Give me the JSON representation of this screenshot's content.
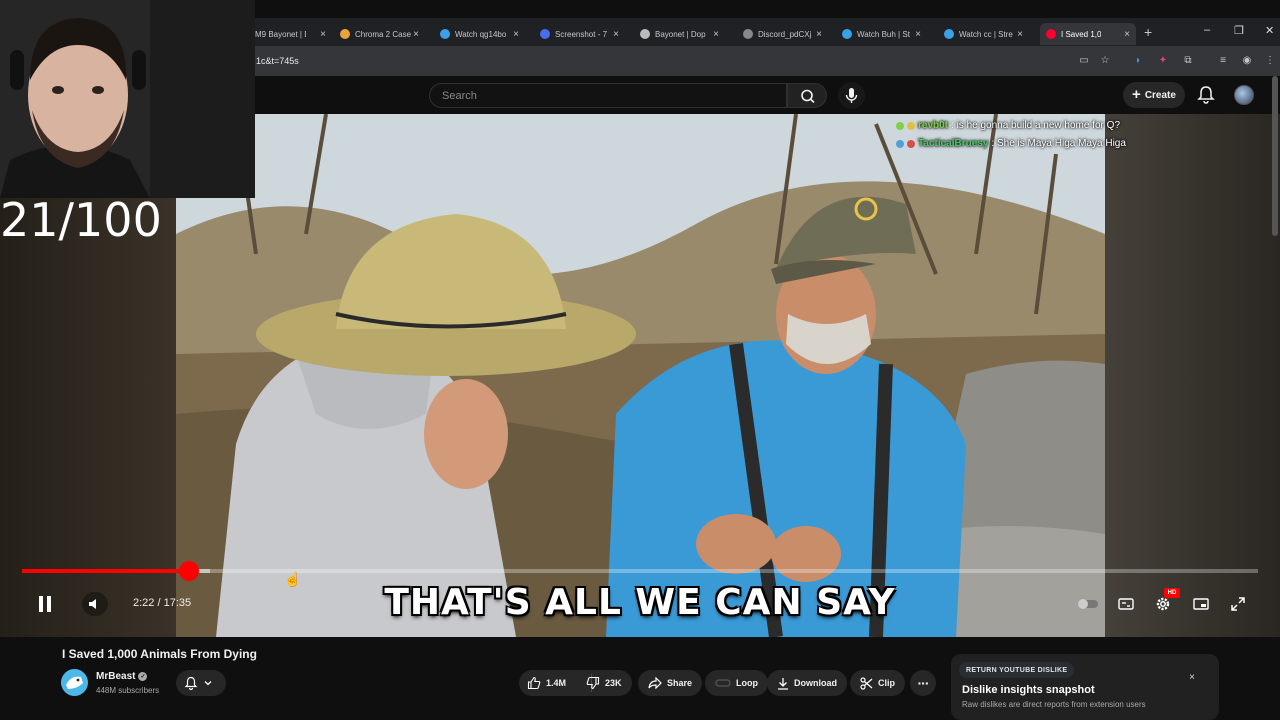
{
  "browser": {
    "tabs": [
      {
        "label": "M9 Bayonet | D",
        "favicon": "none-icon",
        "active": false
      },
      {
        "label": "Chroma 2 Case",
        "favicon": "case-icon",
        "active": false
      },
      {
        "label": "Watch qg14bo",
        "favicon": "watch-icon",
        "active": false
      },
      {
        "label": "Screenshot - 7",
        "favicon": "screenshot-icon",
        "active": false
      },
      {
        "label": "Bayonet | Dop",
        "favicon": "bayonet-icon",
        "active": false
      },
      {
        "label": "Discord_pdCXj",
        "favicon": "globe-icon",
        "active": false
      },
      {
        "label": "Watch Buh | St",
        "favicon": "watch-icon",
        "active": false
      },
      {
        "label": "Watch cc | Stre",
        "favicon": "watch-icon",
        "active": false
      },
      {
        "label": "I Saved 1,0",
        "favicon": "youtube-icon",
        "active": true
      }
    ],
    "url": "1c&t=745s",
    "new_tab": "+",
    "window_controls": {
      "minimize": "–",
      "restore": "❐",
      "close": "✕"
    }
  },
  "youtube_header": {
    "search_placeholder": "Search",
    "create_label": "Create"
  },
  "overlay": {
    "counter": "21/100"
  },
  "chat": [
    {
      "user": "revb0t",
      "message": ": is he gonna build a new home for Q?",
      "color": "#7fd14a"
    },
    {
      "user": "TacticalBruesy",
      "message": ": She is Maya Higa Maya Higa",
      "color": "#4fc66b"
    }
  ],
  "player": {
    "subtitle": "THAT'S ALL WE CAN SAY",
    "time": "2:22 / 17:35",
    "progress_fraction": 0.135,
    "buffered_fraction": 0.152,
    "hd_badge": "HD"
  },
  "video": {
    "title": "I Saved 1,000 Animals From Dying",
    "channel": "MrBeast",
    "verified_mark": "✓",
    "subscribers": "448M subscribers"
  },
  "actions": {
    "likes": "1.4M",
    "dislikes": "23K",
    "share": "Share",
    "loop": "Loop",
    "download": "Download",
    "clip": "Clip"
  },
  "ryd_panel": {
    "badge": "RETURN YOUTUBE DISLIKE",
    "title": "Dislike insights snapshot",
    "subtitle": "Raw dislikes are direct reports from extension users",
    "close": "×"
  },
  "colors": {
    "progress": "#ff0000",
    "youtube_red": "#ff0033",
    "background": "#0f0f0f"
  }
}
